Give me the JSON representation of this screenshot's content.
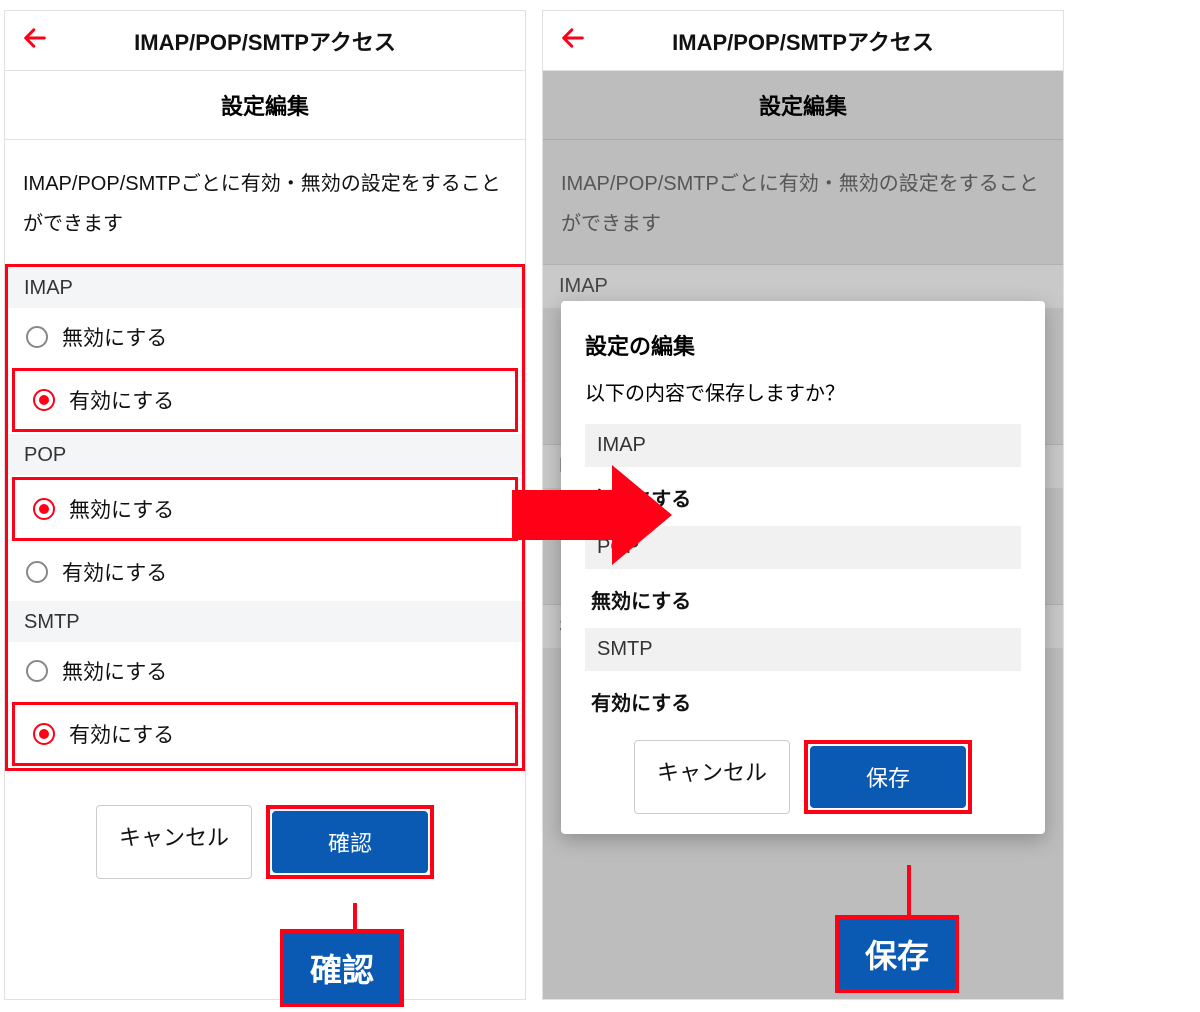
{
  "left": {
    "header_title": "IMAP/POP/SMTPアクセス",
    "subheader": "設定編集",
    "description": "IMAP/POP/SMTPごとに有効・無効の設定をすることができます",
    "sections": [
      {
        "name": "IMAP",
        "options": [
          "無効にする",
          "有効にする"
        ],
        "selected_index": 1,
        "highlight_index": 1
      },
      {
        "name": "POP",
        "options": [
          "無効にする",
          "有効にする"
        ],
        "selected_index": 0,
        "highlight_index": 0
      },
      {
        "name": "SMTP",
        "options": [
          "無効にする",
          "有効にする"
        ],
        "selected_index": 1,
        "highlight_index": 1
      }
    ],
    "cancel_label": "キャンセル",
    "confirm_label": "確認",
    "callout": "確認"
  },
  "right": {
    "header_title": "IMAP/POP/SMTPアクセス",
    "subheader": "設定編集",
    "description": "IMAP/POP/SMTPごとに有効・無効の設定をすることができます",
    "peek_labels": {
      "imap": "IMAP",
      "p": "P",
      "s": "S"
    },
    "modal": {
      "title": "設定の編集",
      "question": "以下の内容で保存しますか？",
      "rows": [
        {
          "proto": "IMAP",
          "value": "有効にする"
        },
        {
          "proto": "POP",
          "value": "無効にする"
        },
        {
          "proto": "SMTP",
          "value": "有効にする"
        }
      ],
      "cancel_label": "キャンセル",
      "save_label": "保存"
    },
    "callout": "保存"
  },
  "colors": {
    "accent_red": "#ff0016",
    "primary_blue": "#0a5ab4"
  }
}
